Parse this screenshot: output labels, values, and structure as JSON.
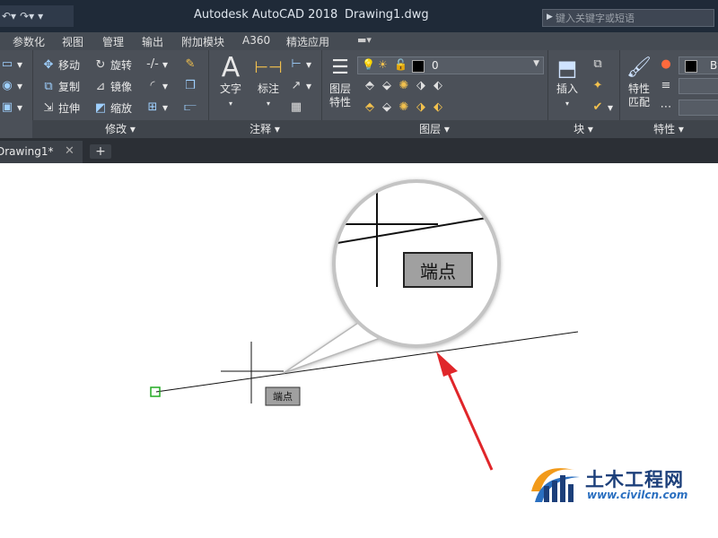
{
  "titlebar": {
    "app_title": "Autodesk AutoCAD 2018",
    "file_title": "Drawing1.dwg",
    "search_placeholder": "键入关键字或短语"
  },
  "menu_tabs": [
    "参数化",
    "视图",
    "管理",
    "输出",
    "附加模块",
    "A360",
    "精选应用"
  ],
  "ribbon": {
    "modify": {
      "footer": "修改 ▾",
      "buttons": [
        "移动",
        "旋转",
        "复制",
        "镜像",
        "拉伸",
        "缩放"
      ]
    },
    "annotation": {
      "footer": "注释 ▾",
      "text_label": "文字",
      "dim_label": "标注"
    },
    "layers": {
      "footer": "图层 ▾",
      "properties_label_1": "图层",
      "properties_label_2": "特性",
      "current_layer": "0"
    },
    "block": {
      "footer": "块 ▾",
      "insert_label": "插入"
    },
    "properties": {
      "footer": "特性 ▾",
      "match_label_1": "特性",
      "match_label_2": "匹配",
      "color_value": "By"
    }
  },
  "doc_tabs": {
    "active": "Drawing1*",
    "close_glyph": "✕",
    "new_glyph": "+"
  },
  "canvas": {
    "snap_tooltip": "端点",
    "magnified_tooltip": "端点"
  },
  "watermark": {
    "name": "土木工程网",
    "url": "www.civilcn.com"
  },
  "icons": {
    "endpoint_marker_color": "#22aa22",
    "arrow_color": "#e0262a"
  }
}
